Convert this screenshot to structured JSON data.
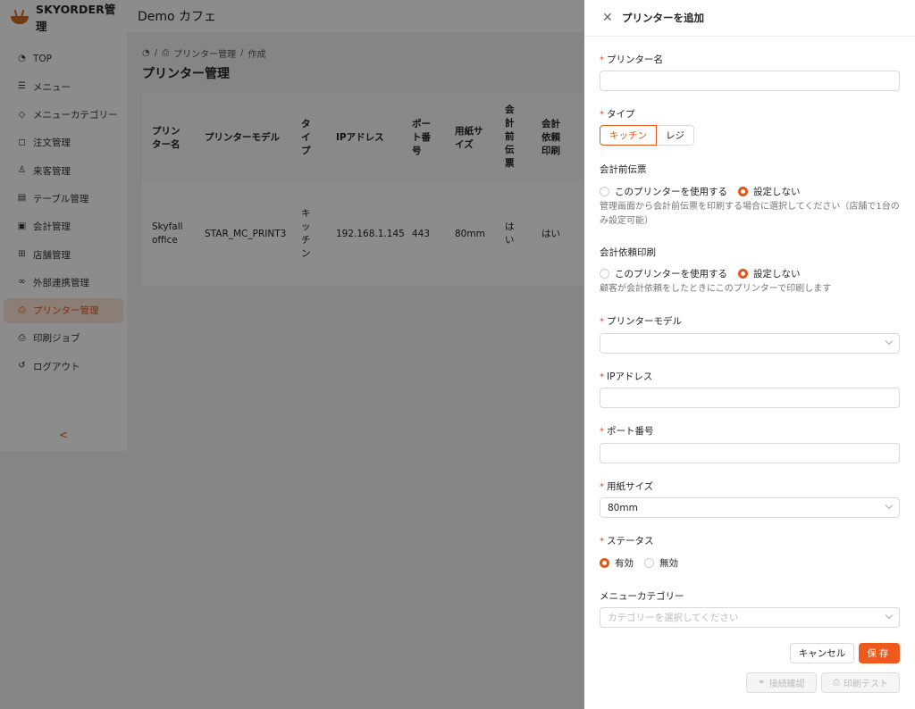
{
  "app": {
    "brand": "SKYORDER管理",
    "header_title": "Demo カフェ"
  },
  "sidebar": {
    "items": [
      {
        "label": "TOP",
        "icon": "dashboard-icon"
      },
      {
        "label": "メニュー",
        "icon": "list-icon"
      },
      {
        "label": "メニューカテゴリー",
        "icon": "tag-icon"
      },
      {
        "label": "注文管理",
        "icon": "bag-icon"
      },
      {
        "label": "来客管理",
        "icon": "user-icon"
      },
      {
        "label": "テーブル管理",
        "icon": "table-icon"
      },
      {
        "label": "会計管理",
        "icon": "receipt-icon"
      },
      {
        "label": "店舗管理",
        "icon": "shop-icon"
      },
      {
        "label": "外部連携管理",
        "icon": "link-icon"
      },
      {
        "label": "プリンター管理",
        "icon": "printer-icon",
        "active": true
      },
      {
        "label": "印刷ジョブ",
        "icon": "printer-icon"
      },
      {
        "label": "ログアウト",
        "icon": "logout-icon"
      }
    ],
    "collapse_glyph": "<"
  },
  "breadcrumb": {
    "sep": "/",
    "section": "プリンター管理",
    "current": "作成"
  },
  "page_title": "プリンター管理",
  "table": {
    "headers": [
      "プリン ター名",
      "プリンターモデル",
      "タ イ プ",
      "IPアドレス",
      "ポー ト番 号",
      "用紙サ イズ",
      "会 計 前 伝 票",
      "会計 依頼 印刷"
    ],
    "row": [
      "Skyfall office",
      "STAR_MC_PRINT3",
      "キ ッ チ ン",
      "192.168.1.145",
      "443",
      "80mm",
      "は い",
      "はい"
    ]
  },
  "drawer": {
    "title": "プリンターを追加",
    "printer_name": {
      "label": "プリンター名",
      "value": ""
    },
    "type": {
      "label": "タイプ",
      "options": [
        "キッチン",
        "レジ"
      ],
      "selected": "キッチン"
    },
    "pre_receipt": {
      "label": "会計前伝票",
      "options": [
        "このプリンターを使用する",
        "設定しない"
      ],
      "selected": "設定しない",
      "help": "管理画面から会計前伝票を印刷する場合に選択してください（店舗で1台のみ設定可能）"
    },
    "checkout_request": {
      "label": "会計依頼印刷",
      "options": [
        "このプリンターを使用する",
        "設定しない"
      ],
      "selected": "設定しない",
      "help": "顧客が会計依頼をしたときにこのプリンターで印刷します"
    },
    "printer_model": {
      "label": "プリンターモデル",
      "value": ""
    },
    "ip_address": {
      "label": "IPアドレス",
      "value": ""
    },
    "port": {
      "label": "ポート番号",
      "value": ""
    },
    "paper_size": {
      "label": "用紙サイズ",
      "value": "80mm"
    },
    "status": {
      "label": "ステータス",
      "options": [
        "有効",
        "無効"
      ],
      "selected": "有効"
    },
    "menu_category": {
      "label": "メニューカテゴリー",
      "placeholder": "カテゴリーを選択してください"
    },
    "buttons": {
      "cancel": "キャンセル",
      "save": "保存",
      "connection_check": "接続確認",
      "print_test": "印刷テスト"
    },
    "required_mark": "*"
  },
  "colors": {
    "accent": "#ee5a1b",
    "active_bg": "#fde6d8"
  }
}
